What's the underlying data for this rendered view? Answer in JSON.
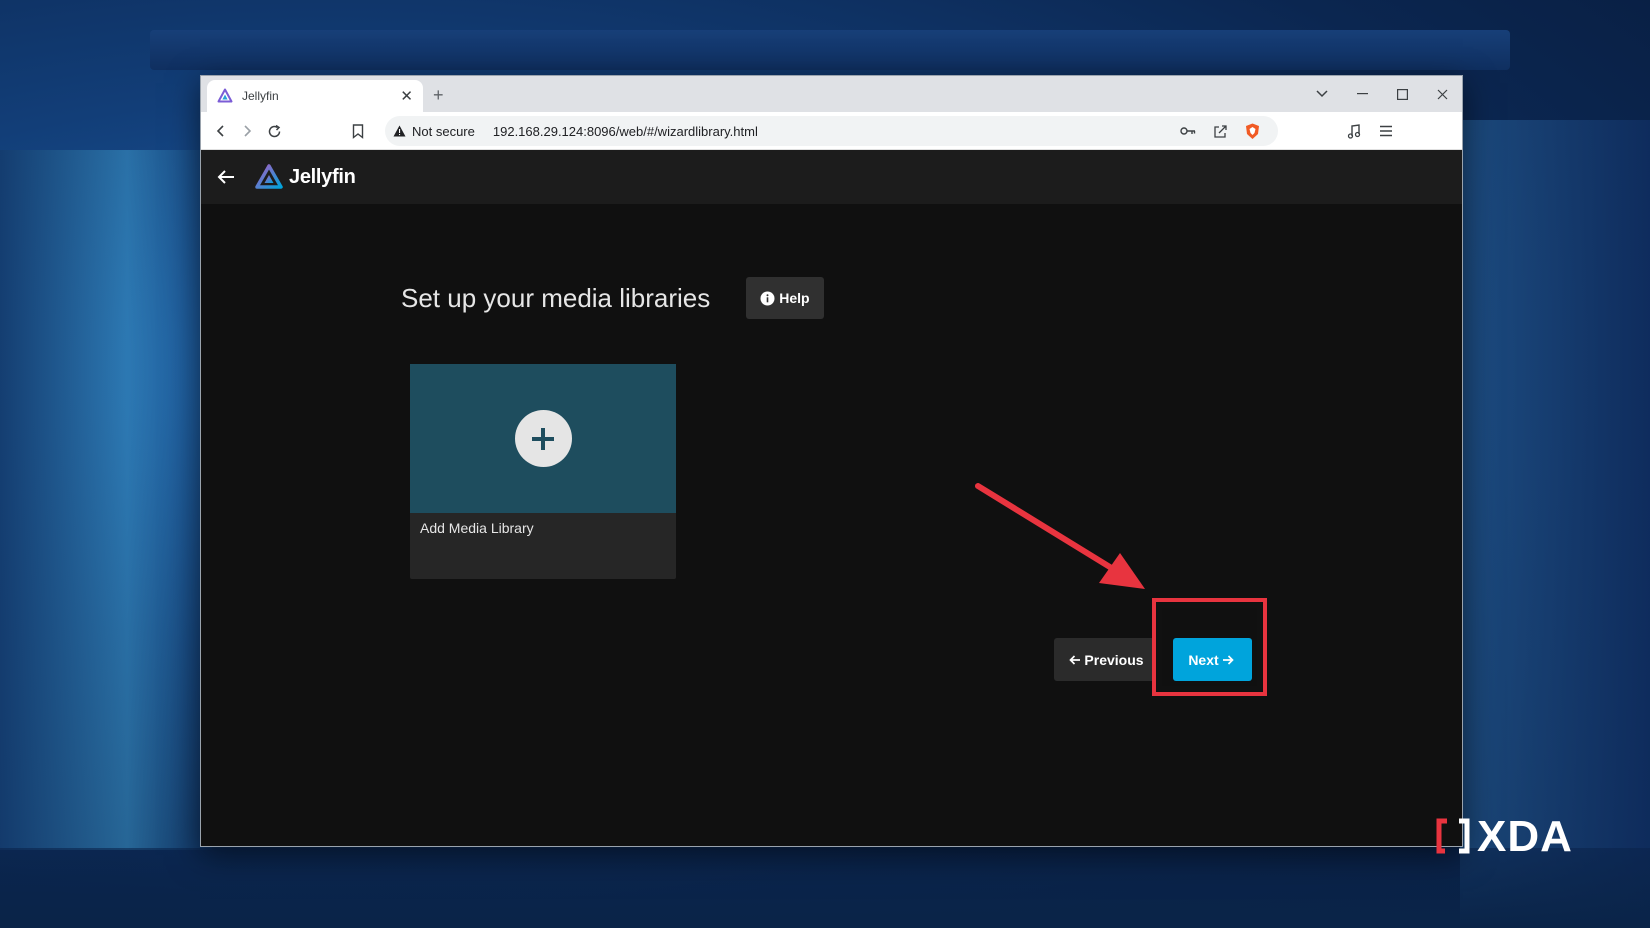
{
  "browser": {
    "tab_title": "Jellyfin",
    "security_label": "Not secure",
    "url": "192.168.29.124:8096/web/#/wizardlibrary.html"
  },
  "app": {
    "logo_text": "Jellyfin",
    "page_title": "Set up your media libraries",
    "help_label": "Help",
    "add_library_label": "Add Media Library",
    "previous_label": "Previous",
    "next_label": "Next"
  },
  "colors": {
    "accent": "#00a4dc",
    "card_image": "#1e4d5e",
    "annotation": "#e8343f"
  },
  "watermark": {
    "text": "XDA"
  }
}
